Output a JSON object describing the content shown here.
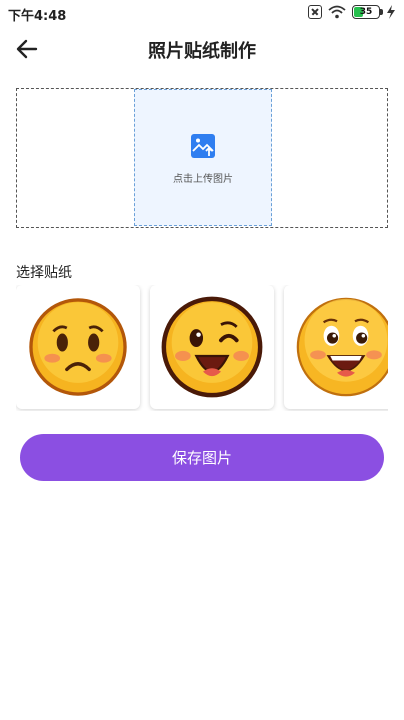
{
  "status_bar": {
    "time": "下午4:48",
    "battery": "35"
  },
  "header": {
    "title": "照片贴纸制作"
  },
  "upload": {
    "label": "点击上传图片"
  },
  "stickers": {
    "section_label": "选择贴纸",
    "items": [
      {
        "icon": "sad-face-sticker-icon"
      },
      {
        "icon": "winking-face-sticker-icon"
      },
      {
        "icon": "grinning-face-sticker-icon"
      }
    ]
  },
  "actions": {
    "save_label": "保存图片"
  },
  "colors": {
    "primary": "#8b4fe2",
    "upload_bg": "#eef5ff",
    "accent_blue": "#2f7ef0"
  }
}
